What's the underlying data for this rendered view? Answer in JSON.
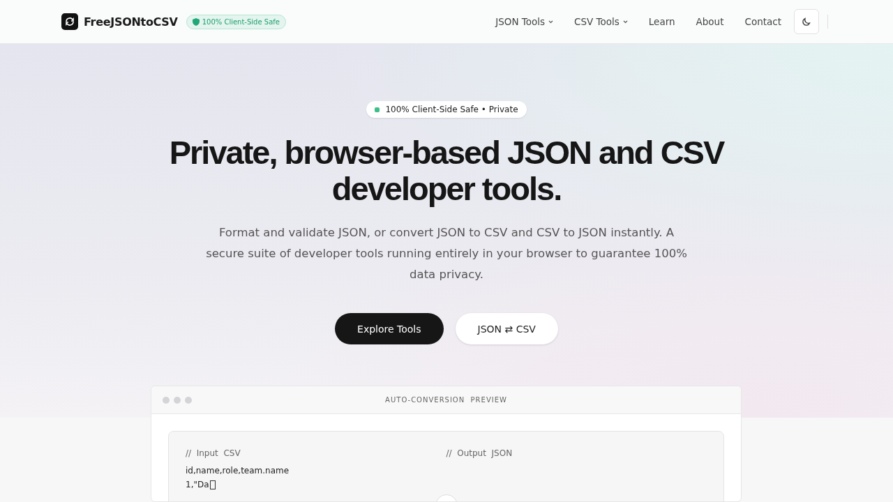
{
  "header": {
    "brand": "FreeJSONtoCSV",
    "badge": "100% Client-Side Safe",
    "nav": [
      {
        "label": "JSON Tools",
        "dropdown": true
      },
      {
        "label": "CSV Tools",
        "dropdown": true
      },
      {
        "label": "Learn",
        "dropdown": false
      },
      {
        "label": "About",
        "dropdown": false
      },
      {
        "label": "Contact",
        "dropdown": false
      }
    ]
  },
  "hero": {
    "pill": "100% Client-Side Safe • Private",
    "title": "Private, browser-based JSON and CSV developer tools.",
    "subtitle": "Format and validate JSON, or convert JSON to CSV and CSV to JSON instantly. A secure suite of developer tools running entirely in your browser to guarantee 100% data privacy.",
    "buttons": [
      {
        "label": "Explore Tools",
        "kind": "primary"
      },
      {
        "label": "JSON ⇄ CSV",
        "kind": "secondary"
      }
    ]
  },
  "preview": {
    "title": "AUTO-CONVERSION  PREVIEW",
    "input_label": "//  Input  CSV",
    "output_label": "//  Output  JSON",
    "input_lines": [
      "id,name,role,team.name",
      "1,\"Da"
    ]
  }
}
